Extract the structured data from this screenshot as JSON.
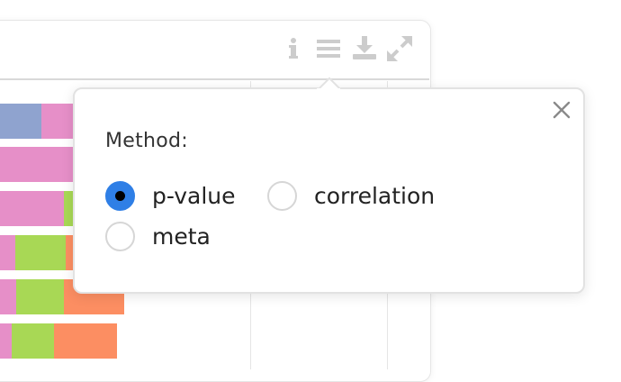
{
  "toolbar": {
    "icons": [
      "info-icon",
      "menu-icon",
      "download-icon",
      "expand-icon"
    ]
  },
  "chart_background": {
    "colors": {
      "blue": "#8fa3cf",
      "pink": "#e68fc8",
      "green": "#a8d855",
      "orange": "#fc8e62"
    }
  },
  "popover": {
    "title": "Method:",
    "options": [
      {
        "label": "p-value",
        "checked": true
      },
      {
        "label": "correlation",
        "checked": false
      },
      {
        "label": "meta",
        "checked": false
      }
    ],
    "close_icon": "close-icon",
    "accent_color": "#2f7fe6"
  }
}
